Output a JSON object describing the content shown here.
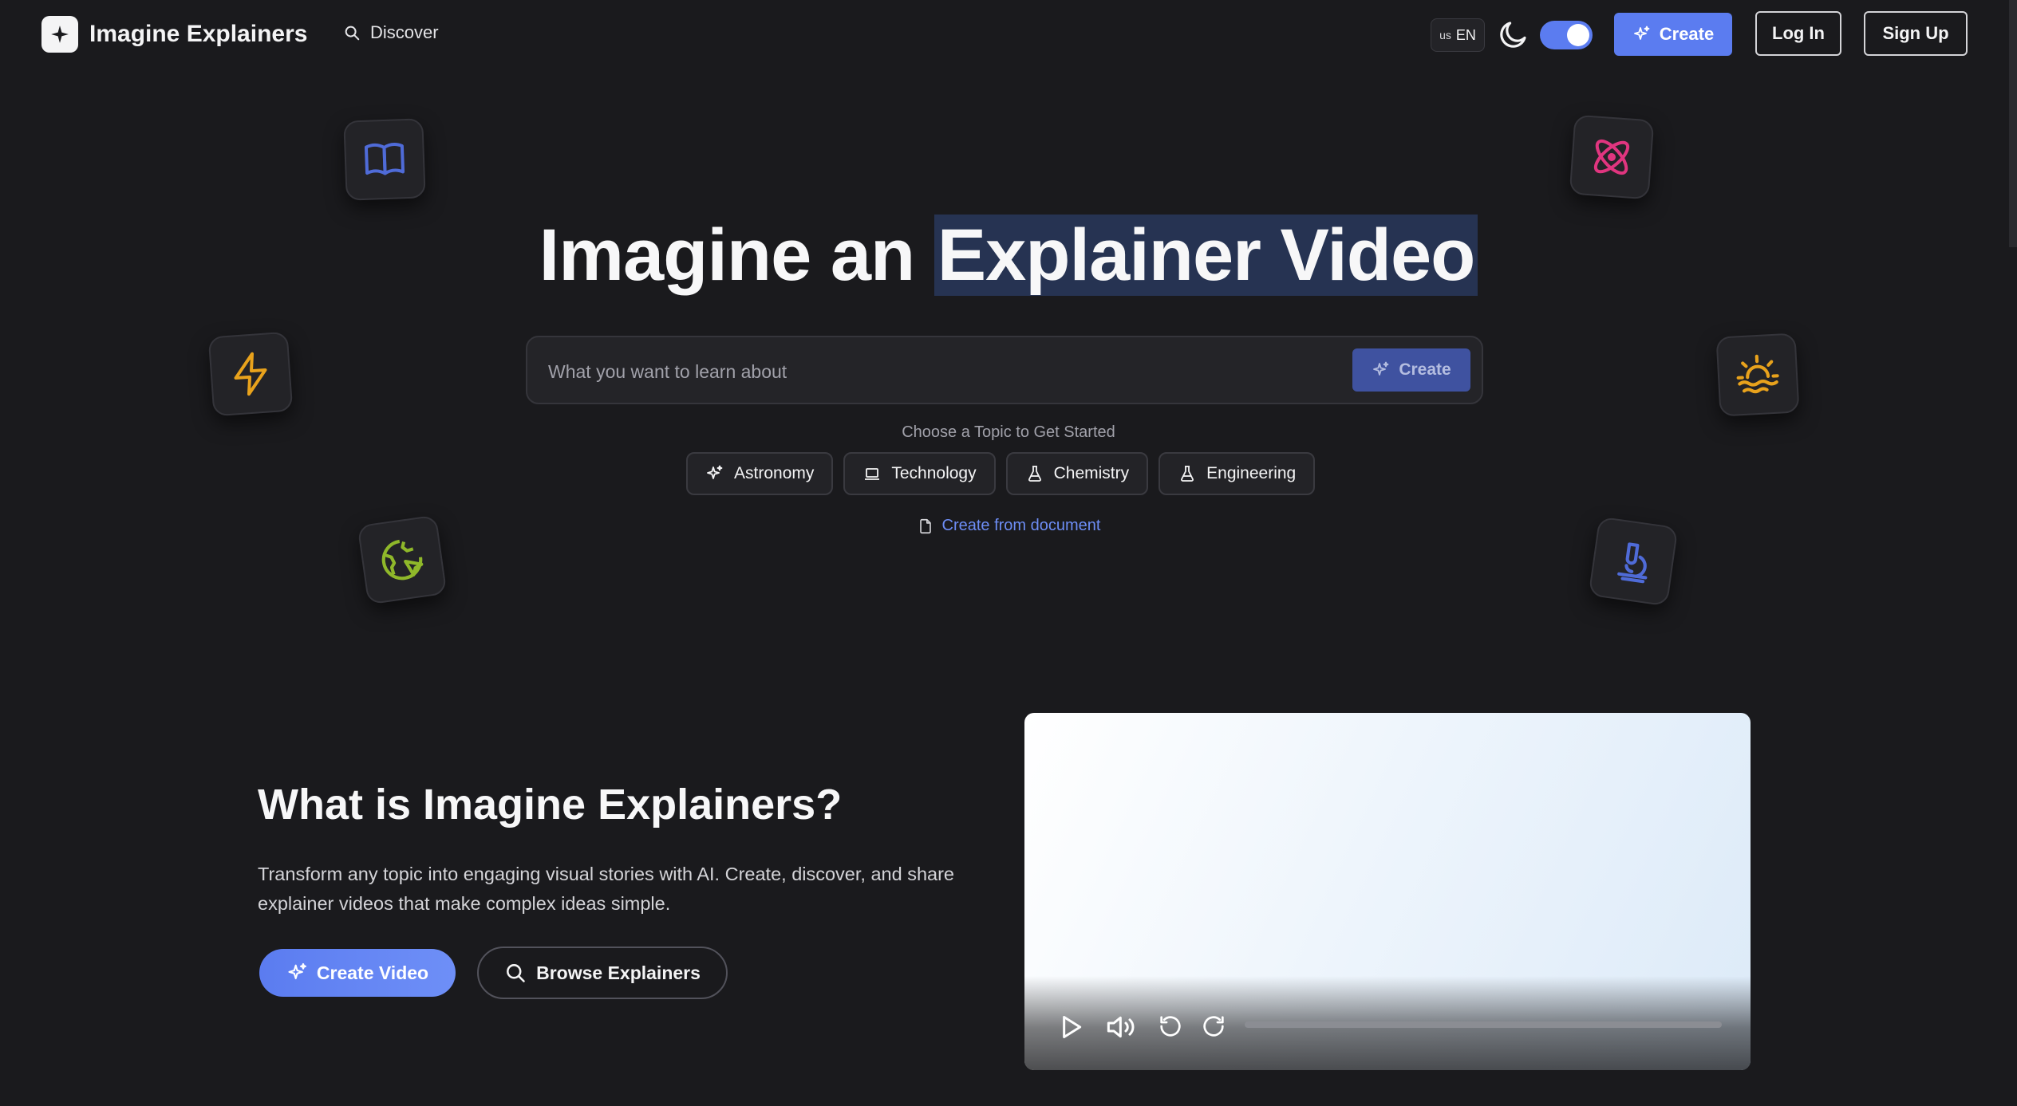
{
  "header": {
    "brand": "Imagine Explainers",
    "nav_discover": "Discover",
    "lang_flag": "us",
    "lang_code": "EN",
    "create_label": "Create",
    "login_label": "Log In",
    "signup_label": "Sign Up",
    "theme_toggle_on": true
  },
  "hero": {
    "title_prefix": "Imagine an ",
    "title_highlight": "Explainer Video",
    "search_placeholder": "What you want to learn about",
    "search_value": "",
    "search_create_label": "Create",
    "topic_caption": "Choose a Topic to Get Started",
    "topics": [
      {
        "label": "Astronomy",
        "icon": "sparkles-icon"
      },
      {
        "label": "Technology",
        "icon": "laptop-icon"
      },
      {
        "label": "Chemistry",
        "icon": "flask-icon"
      },
      {
        "label": "Engineering",
        "icon": "flask-icon"
      }
    ],
    "doc_link": "Create from document"
  },
  "floating_icons": [
    {
      "name": "book-icon",
      "color": "#4f6bd8"
    },
    {
      "name": "atom-icon",
      "color": "#e0357f"
    },
    {
      "name": "lightning-icon",
      "color": "#e8a21c"
    },
    {
      "name": "sunrise-icon",
      "color": "#e8a21c"
    },
    {
      "name": "globe-icon",
      "color": "#8fb82a"
    },
    {
      "name": "microscope-icon",
      "color": "#4f6bd8"
    }
  ],
  "about": {
    "title": "What is Imagine Explainers?",
    "description": "Transform any topic into engaging visual stories with AI. Create, discover, and share explainer videos that make complex ideas simple.",
    "create_video_label": "Create Video",
    "browse_label": "Browse Explainers"
  },
  "video": {
    "progress": 0
  },
  "colors": {
    "accent": "#5b7cf0",
    "background": "#1a1a1d",
    "link": "#6d8df5"
  }
}
